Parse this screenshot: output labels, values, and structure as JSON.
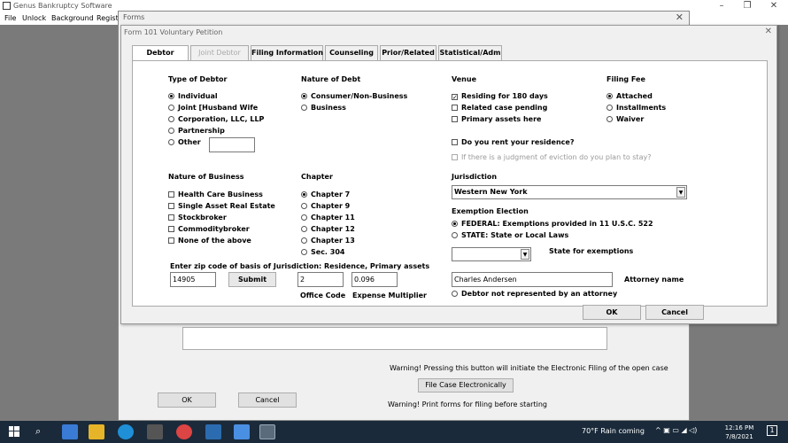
{
  "app": {
    "title": "Genus Bankruptcy Software",
    "menu": [
      "File",
      "Unlock",
      "Background",
      "Registe"
    ]
  },
  "forms_window": {
    "title": "Forms",
    "warning1": "Warning! Pressing this button will initiate the Electronic Filing of the open case",
    "efile_button": "File Case Electronically",
    "warning2": "Warning! Print forms for filing before starting",
    "ok": "OK",
    "cancel": "Cancel"
  },
  "dialog": {
    "title": "Form 101 Voluntary Petition",
    "tabs": [
      {
        "label": "Debtor",
        "state": "active"
      },
      {
        "label": "Joint Debtor",
        "state": "disabled"
      },
      {
        "label": "Filing Information",
        "state": "normal"
      },
      {
        "label": "Counseling",
        "state": "normal"
      },
      {
        "label": "Prior/Related",
        "state": "normal"
      },
      {
        "label": "Statistical/Adm",
        "state": "normal"
      }
    ],
    "type_of_debtor": {
      "heading": "Type of Debtor",
      "options": [
        "Individual",
        "Joint [Husband  Wife",
        "Corporation, LLC, LLP",
        "Partnership",
        "Other"
      ],
      "selected": "Individual",
      "other_value": ""
    },
    "nature_of_debt": {
      "heading": "Nature of Debt",
      "options": [
        "Consumer/Non-Business",
        "Business"
      ],
      "selected": "Consumer/Non-Business"
    },
    "venue": {
      "heading": "Venue",
      "options": [
        {
          "label": "Residing for 180 days",
          "checked": true
        },
        {
          "label": "Related case pending",
          "checked": false
        },
        {
          "label": "Primary assets here",
          "checked": false
        }
      ],
      "rent_question": "Do you rent your residence?",
      "eviction_question": "If there is a judgment of eviction do you plan to stay?"
    },
    "filing_fee": {
      "heading": "Filing Fee",
      "options": [
        "Attached",
        "Installments",
        "Waiver"
      ],
      "selected": "Attached"
    },
    "nature_of_business": {
      "heading": "Nature of Business",
      "options": [
        "Health Care Business",
        "Single Asset Real Estate",
        "Stockbroker",
        "Commoditybroker",
        "None of the above"
      ]
    },
    "chapter": {
      "heading": "Chapter",
      "options": [
        "Chapter 7",
        "Chapter 9",
        "Chapter 11",
        "Chapter 12",
        "Chapter 13",
        "Sec. 304"
      ],
      "selected": "Chapter 7"
    },
    "jurisdiction": {
      "heading": "Jurisdiction",
      "value": "Western New York"
    },
    "exemption": {
      "heading": "Exemption Election",
      "options": [
        "FEDERAL: Exemptions provided in 11 U.S.C. 522",
        "STATE: State or Local Laws"
      ],
      "selected": "FEDERAL: Exemptions provided in 11 U.S.C. 522",
      "state_label": "State for exemptions",
      "state_value": ""
    },
    "zip": {
      "label": "Enter zip code of basis of Jurisdiction: Residence, Primary assets",
      "value": "14905",
      "submit": "Submit",
      "office_code": "2",
      "expense_multiplier": "0.096",
      "office_code_label": "Office Code",
      "expense_multiplier_label": "Expense Multiplier"
    },
    "attorney": {
      "value": "Charles Andersen",
      "label": "Attorney name",
      "not_represented": "Debtor not represented by an attorney"
    },
    "ok": "OK",
    "cancel": "Cancel"
  },
  "taskbar": {
    "weather": "70°F  Rain coming",
    "time": "12:16 PM",
    "date": "7/8/2021",
    "notification_count": "1"
  }
}
